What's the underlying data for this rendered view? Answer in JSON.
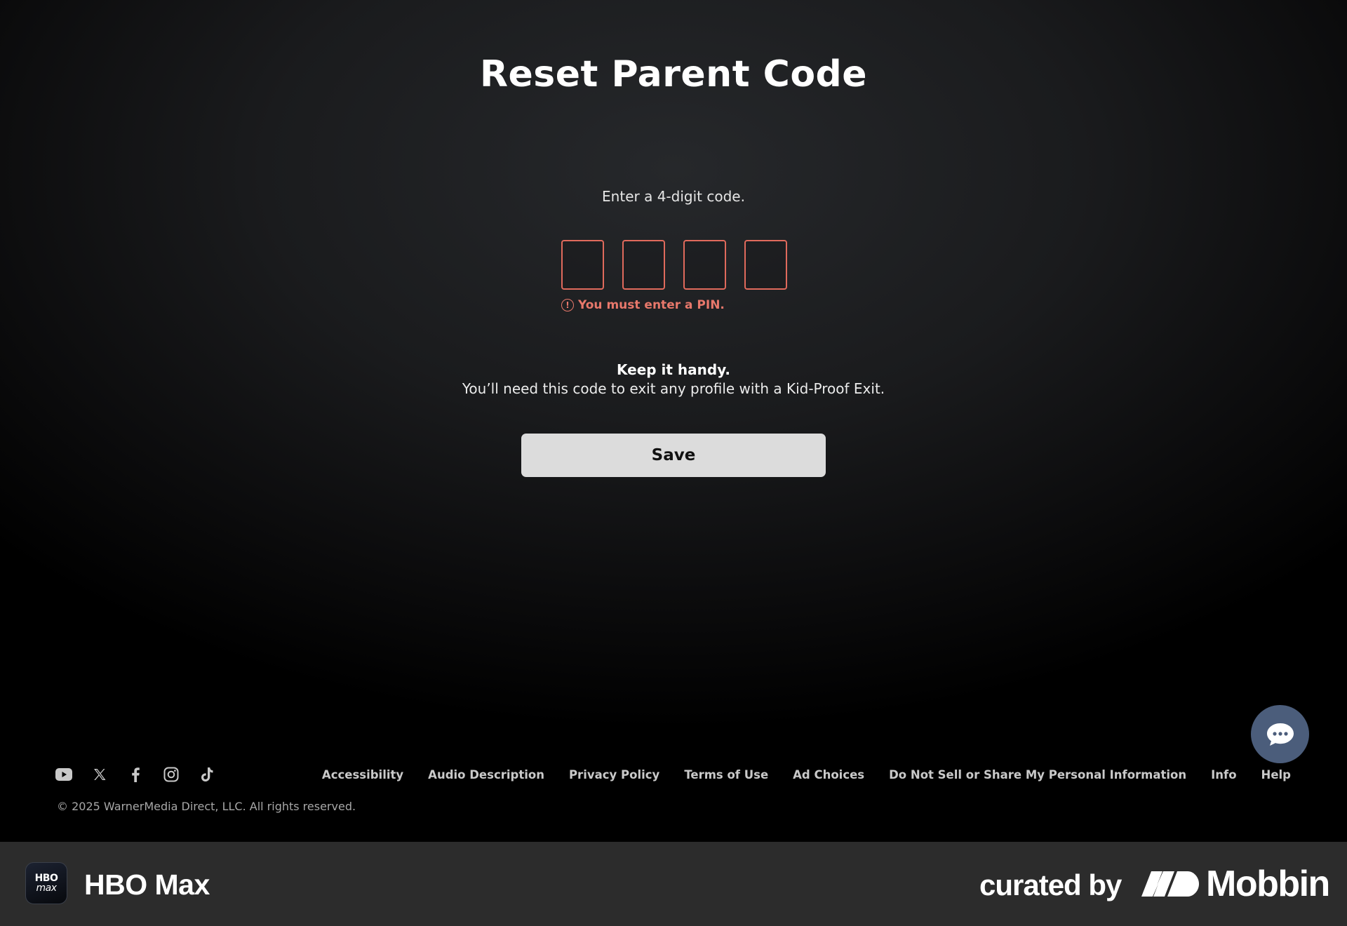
{
  "page": {
    "title": "Reset Parent Code",
    "instructions": "Enter a 4-digit code.",
    "pin": {
      "digits": [
        "",
        "",
        "",
        ""
      ],
      "error_message": "You must enter a PIN.",
      "error_icon_glyph": "!",
      "error_color": "#e8786b"
    },
    "reminder": {
      "title": "Keep it handy.",
      "text": "You’ll need this code to exit any profile with a Kid-Proof Exit."
    },
    "save_label": "Save"
  },
  "footer": {
    "social_icons": [
      "youtube-icon",
      "x-icon",
      "facebook-icon",
      "instagram-icon",
      "tiktok-icon"
    ],
    "links": [
      "Accessibility",
      "Audio Description",
      "Privacy Policy",
      "Terms of Use",
      "Ad Choices",
      "Do Not Sell or Share My Personal Information",
      "Info",
      "Help"
    ],
    "copyright": "© 2025 WarnerMedia Direct, LLC. All rights reserved.",
    "chat_icon": "chat-bubble-icon",
    "chat_color": "#4b5d7b"
  },
  "attribution": {
    "app_logo_line1": "HBO",
    "app_logo_line2": "max",
    "app_name": "HBO Max",
    "curated_by": "curated by",
    "brand": "Mobbin"
  }
}
